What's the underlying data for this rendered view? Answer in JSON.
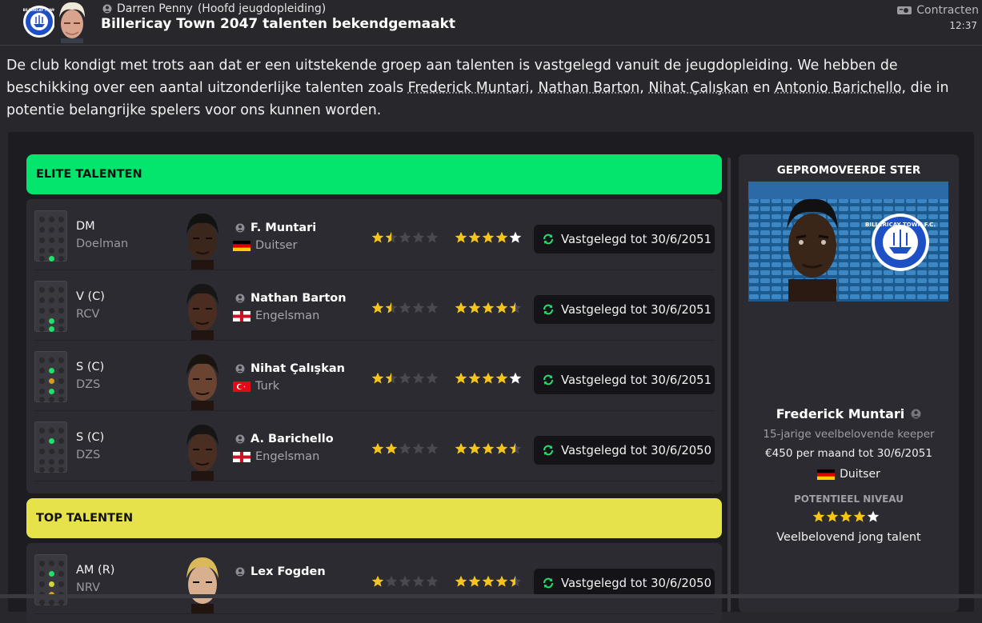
{
  "header": {
    "sender_name": "Darren Penny",
    "sender_role": "(Hoofd jeugdopleiding)",
    "title": "Billericay Town 2047 talenten bekendgemaakt",
    "contracts_label": "Contracten",
    "time": "12:37",
    "crest_text": "BILLERICAY TOWN"
  },
  "message": {
    "text_before": "De club kondigt met trots aan dat er een uitstekende groep aan talenten is vastgelegd vanuit de jeugdopleiding. We hebben de beschikking over een aantal uitzonderlijke talenten zoals ",
    "links": [
      "Frederick Muntari",
      "Nathan Barton",
      "Nihat Çalışkan",
      "Antonio Barichello"
    ],
    "sep1": ", ",
    "sep2": ", ",
    "sep3": " en ",
    "text_after": ", die in potentie belangrijke spelers voor ons kunnen worden."
  },
  "elite": {
    "heading": "ELITE TALENTEN",
    "color": "#04e56d",
    "players": [
      {
        "position": "DM",
        "role": "Doelman",
        "name": "F. Muntari",
        "nationality": "Duitser",
        "flag": "germany",
        "current_stars": 1.5,
        "potential_stars": 5,
        "contract": "Vastgelegd tot 30/6/2051",
        "pitch_dots": [
          [
            1,
            3,
            "on"
          ]
        ]
      },
      {
        "position": "V (C)",
        "role": "RCV",
        "name": "Nathan Barton",
        "nationality": "Engelsman",
        "flag": "england",
        "current_stars": 1.5,
        "potential_stars": 4.5,
        "contract": "Vastgelegd tot 30/6/2051",
        "pitch_dots": [
          [
            1,
            2,
            "on"
          ],
          [
            1,
            3,
            "on"
          ]
        ]
      },
      {
        "position": "S (C)",
        "role": "DZS",
        "name": "Nihat Çalışkan",
        "nationality": "Turk",
        "flag": "turkey",
        "current_stars": 1.5,
        "potential_stars": 5,
        "contract": "Vastgelegd tot 30/6/2051",
        "pitch_dots": [
          [
            1,
            0,
            "on"
          ],
          [
            1,
            1,
            "amber"
          ],
          [
            1,
            2,
            "on"
          ]
        ]
      },
      {
        "position": "S (C)",
        "role": "DZS",
        "name": "A. Barichello",
        "nationality": "Engelsman",
        "flag": "england",
        "current_stars": 2,
        "potential_stars": 4.5,
        "contract": "Vastgelegd tot 30/6/2050",
        "pitch_dots": [
          [
            1,
            0,
            "on"
          ]
        ]
      }
    ]
  },
  "top": {
    "heading": "TOP TALENTEN",
    "color": "#e6e24a",
    "players": [
      {
        "position": "AM (R)",
        "role": "NRV",
        "name": "Lex Fogden",
        "current_stars": 1,
        "potential_stars": 4.5,
        "contract": "Vastgelegd tot 30/6/2050",
        "pitch_dots": [
          [
            1,
            0,
            "on"
          ],
          [
            1,
            1,
            "yel"
          ],
          [
            1,
            2,
            "amber"
          ]
        ]
      }
    ]
  },
  "star_card": {
    "title": "GEPROMOVEERDE STER",
    "name": "Frederick Muntari",
    "description": "15-jarige veelbelovende keeper",
    "wage": "€450 per maand tot 30/6/2051",
    "nationality": "Duitser",
    "potential_label": "POTENTIEEL NIVEAU",
    "potential_stars": 5,
    "potential_desc": "Veelbelovend jong talent",
    "crest_text": "BILLERICAY TOWN F.C."
  },
  "colors": {
    "accent_green": "#04e56d",
    "accent_yellow": "#e6e24a",
    "star_gold": "#f5c518",
    "background": "#28272c"
  }
}
